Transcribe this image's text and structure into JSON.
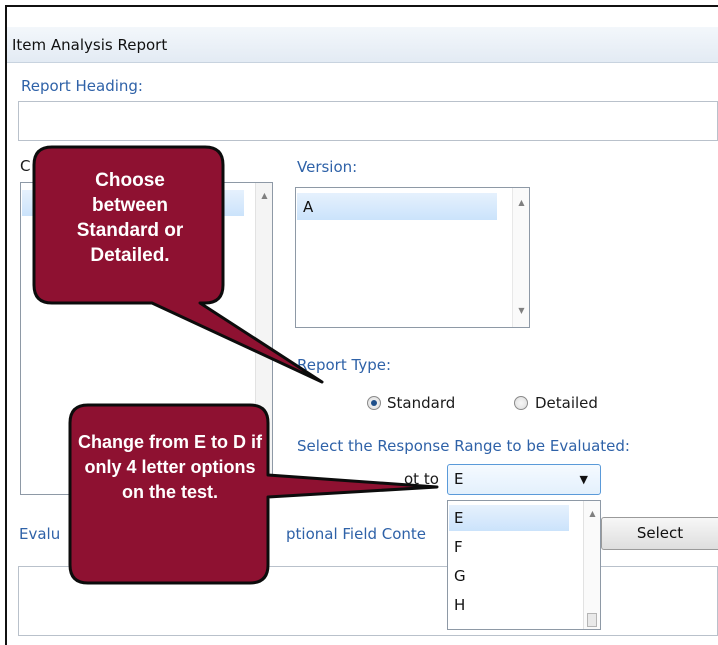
{
  "window": {
    "title": "Item Analysis Report"
  },
  "form": {
    "report_heading_label": "Report Heading:",
    "report_heading_value": "",
    "left_list_label_partial": "C",
    "version_label": "Version:",
    "version_items": [
      "A"
    ],
    "report_type_label": "Report Type:",
    "report_type_options": [
      {
        "label": "Standard",
        "selected": true
      },
      {
        "label": "Detailed",
        "selected": false
      }
    ],
    "response_range_label": "Select the Response Range to be Evaluated:",
    "response_range_prefix_partial": "ot to",
    "response_range_value": "E",
    "response_range_options": [
      "E",
      "F",
      "G",
      "H"
    ],
    "evaluate_label_partial": "Evalu",
    "optional_field_label_partial": "ptional Field Conte",
    "select_button_label": "Select"
  },
  "callouts": [
    {
      "text": "Choose between Standard or Detailed."
    },
    {
      "text": "Change from E to D if only 4 letter options on the test."
    }
  ],
  "colors": {
    "callout_fill": "#8e1131",
    "label_blue": "#2f62a8",
    "selection_blue": "#cbe3fb"
  }
}
